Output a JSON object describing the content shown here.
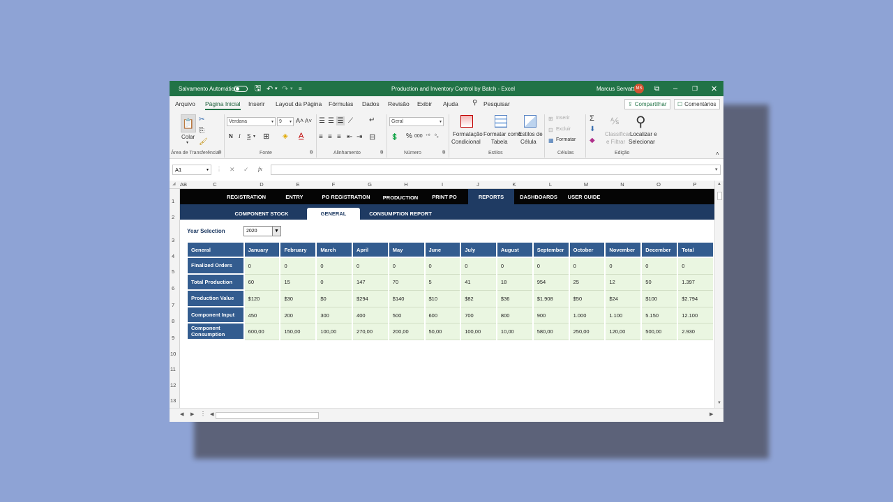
{
  "titlebar": {
    "autosave_label": "Salvamento Automático",
    "window_title": "Production and Inventory Control by Batch  -  Excel",
    "user_name": "Marcus Servatti",
    "user_initials": "MS"
  },
  "menu": {
    "tabs": [
      "Arquivo",
      "Página Inicial",
      "Inserir",
      "Layout da Página",
      "Fórmulas",
      "Dados",
      "Revisão",
      "Exibir",
      "Ajuda"
    ],
    "search_label": "Pesquisar",
    "share_label": "Compartilhar",
    "comments_label": "Comentários"
  },
  "ribbon": {
    "clipboard": {
      "paste_label": "Colar",
      "group_label": "Área de Transferência"
    },
    "font": {
      "family": "Verdana",
      "size": "9",
      "bold": "N",
      "italic": "I",
      "underline": "S",
      "group_label": "Fonte"
    },
    "alignment": {
      "group_label": "Alinhamento"
    },
    "number": {
      "format": "Geral",
      "group_label": "Número"
    },
    "styles": {
      "conditional_line1": "Formatação",
      "conditional_line2": "Condicional",
      "table_line1": "Formatar como",
      "table_line2": "Tabela",
      "cell_line1": "Estilos de",
      "cell_line2": "Célula",
      "group_label": "Estilos"
    },
    "cells": {
      "insert": "Inserir",
      "delete": "Excluir",
      "format": "Formatar",
      "group_label": "Células"
    },
    "editing": {
      "sort_line1": "Classificar",
      "sort_line2": "e Filtrar",
      "find_line1": "Localizar e",
      "find_line2": "Selecionar",
      "group_label": "Edição"
    }
  },
  "formula_bar": {
    "name_box": "A1",
    "fx": "fx",
    "value": ""
  },
  "columns": [
    "AB",
    "C",
    "D",
    "E",
    "F",
    "G",
    "H",
    "I",
    "J",
    "K",
    "L",
    "M",
    "N",
    "O",
    "P"
  ],
  "rows": [
    "1",
    "2",
    "3",
    "4",
    "5",
    "6",
    "7",
    "8",
    "9",
    "10",
    "11",
    "12",
    "13"
  ],
  "nav_primary": [
    "REGISTRATION",
    "ENTRY",
    "PO REGISTRATION",
    "PRODUCTION",
    "PRINT PO",
    "REPORTS",
    "DASHBOARDS",
    "USER GUIDE"
  ],
  "nav_secondary": [
    "COMPONENT STOCK",
    "GENERAL",
    "CONSUMPTION REPORT"
  ],
  "year_selection": {
    "label": "Year Selection",
    "value": "2020"
  },
  "report": {
    "headers": [
      "General",
      "January",
      "February",
      "March",
      "April",
      "May",
      "June",
      "July",
      "August",
      "September",
      "October",
      "November",
      "December",
      "Total"
    ],
    "rows": [
      {
        "label": "Finalized Orders",
        "values": [
          "0",
          "0",
          "0",
          "0",
          "0",
          "0",
          "0",
          "0",
          "0",
          "0",
          "0",
          "0",
          "0"
        ]
      },
      {
        "label": "Total Production",
        "values": [
          "60",
          "15",
          "0",
          "147",
          "70",
          "5",
          "41",
          "18",
          "954",
          "25",
          "12",
          "50",
          "1.397"
        ]
      },
      {
        "label": "Production Value",
        "values": [
          "$120",
          "$30",
          "$0",
          "$294",
          "$140",
          "$10",
          "$82",
          "$36",
          "$1.908",
          "$50",
          "$24",
          "$100",
          "$2.794"
        ]
      },
      {
        "label": "Component Input",
        "values": [
          "450",
          "200",
          "300",
          "400",
          "500",
          "600",
          "700",
          "800",
          "900",
          "1.000",
          "1.100",
          "5.150",
          "12.100"
        ]
      },
      {
        "label": "Component Consumption",
        "values": [
          "600,00",
          "150,00",
          "100,00",
          "270,00",
          "200,00",
          "50,00",
          "100,00",
          "10,00",
          "580,00",
          "250,00",
          "120,00",
          "500,00",
          "2.930"
        ]
      }
    ]
  }
}
